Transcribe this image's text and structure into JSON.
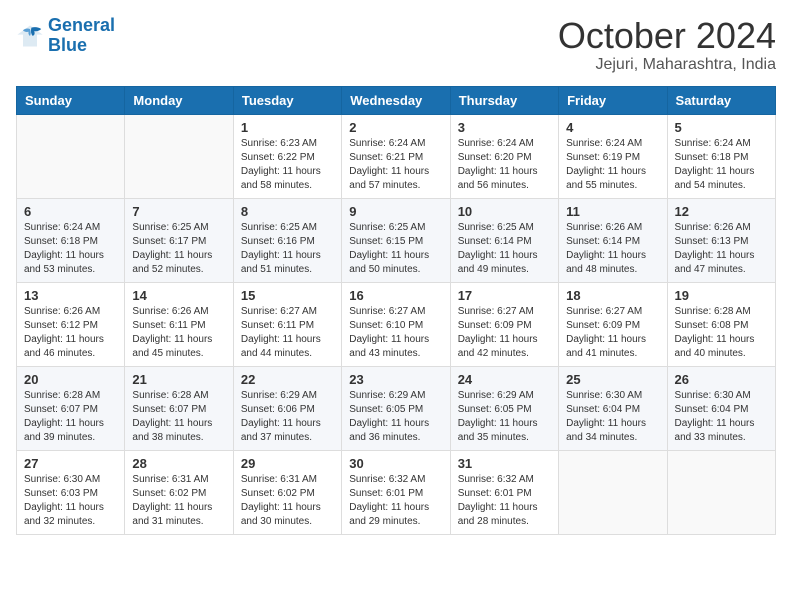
{
  "logo": {
    "general": "General",
    "blue": "Blue"
  },
  "header": {
    "month": "October 2024",
    "location": "Jejuri, Maharashtra, India"
  },
  "weekdays": [
    "Sunday",
    "Monday",
    "Tuesday",
    "Wednesday",
    "Thursday",
    "Friday",
    "Saturday"
  ],
  "weeks": [
    [
      null,
      null,
      {
        "day": 1,
        "sunrise": "6:23 AM",
        "sunset": "6:22 PM",
        "daylight": "11 hours and 58 minutes."
      },
      {
        "day": 2,
        "sunrise": "6:24 AM",
        "sunset": "6:21 PM",
        "daylight": "11 hours and 57 minutes."
      },
      {
        "day": 3,
        "sunrise": "6:24 AM",
        "sunset": "6:20 PM",
        "daylight": "11 hours and 56 minutes."
      },
      {
        "day": 4,
        "sunrise": "6:24 AM",
        "sunset": "6:19 PM",
        "daylight": "11 hours and 55 minutes."
      },
      {
        "day": 5,
        "sunrise": "6:24 AM",
        "sunset": "6:18 PM",
        "daylight": "11 hours and 54 minutes."
      }
    ],
    [
      {
        "day": 6,
        "sunrise": "6:24 AM",
        "sunset": "6:18 PM",
        "daylight": "11 hours and 53 minutes."
      },
      {
        "day": 7,
        "sunrise": "6:25 AM",
        "sunset": "6:17 PM",
        "daylight": "11 hours and 52 minutes."
      },
      {
        "day": 8,
        "sunrise": "6:25 AM",
        "sunset": "6:16 PM",
        "daylight": "11 hours and 51 minutes."
      },
      {
        "day": 9,
        "sunrise": "6:25 AM",
        "sunset": "6:15 PM",
        "daylight": "11 hours and 50 minutes."
      },
      {
        "day": 10,
        "sunrise": "6:25 AM",
        "sunset": "6:14 PM",
        "daylight": "11 hours and 49 minutes."
      },
      {
        "day": 11,
        "sunrise": "6:26 AM",
        "sunset": "6:14 PM",
        "daylight": "11 hours and 48 minutes."
      },
      {
        "day": 12,
        "sunrise": "6:26 AM",
        "sunset": "6:13 PM",
        "daylight": "11 hours and 47 minutes."
      }
    ],
    [
      {
        "day": 13,
        "sunrise": "6:26 AM",
        "sunset": "6:12 PM",
        "daylight": "11 hours and 46 minutes."
      },
      {
        "day": 14,
        "sunrise": "6:26 AM",
        "sunset": "6:11 PM",
        "daylight": "11 hours and 45 minutes."
      },
      {
        "day": 15,
        "sunrise": "6:27 AM",
        "sunset": "6:11 PM",
        "daylight": "11 hours and 44 minutes."
      },
      {
        "day": 16,
        "sunrise": "6:27 AM",
        "sunset": "6:10 PM",
        "daylight": "11 hours and 43 minutes."
      },
      {
        "day": 17,
        "sunrise": "6:27 AM",
        "sunset": "6:09 PM",
        "daylight": "11 hours and 42 minutes."
      },
      {
        "day": 18,
        "sunrise": "6:27 AM",
        "sunset": "6:09 PM",
        "daylight": "11 hours and 41 minutes."
      },
      {
        "day": 19,
        "sunrise": "6:28 AM",
        "sunset": "6:08 PM",
        "daylight": "11 hours and 40 minutes."
      }
    ],
    [
      {
        "day": 20,
        "sunrise": "6:28 AM",
        "sunset": "6:07 PM",
        "daylight": "11 hours and 39 minutes."
      },
      {
        "day": 21,
        "sunrise": "6:28 AM",
        "sunset": "6:07 PM",
        "daylight": "11 hours and 38 minutes."
      },
      {
        "day": 22,
        "sunrise": "6:29 AM",
        "sunset": "6:06 PM",
        "daylight": "11 hours and 37 minutes."
      },
      {
        "day": 23,
        "sunrise": "6:29 AM",
        "sunset": "6:05 PM",
        "daylight": "11 hours and 36 minutes."
      },
      {
        "day": 24,
        "sunrise": "6:29 AM",
        "sunset": "6:05 PM",
        "daylight": "11 hours and 35 minutes."
      },
      {
        "day": 25,
        "sunrise": "6:30 AM",
        "sunset": "6:04 PM",
        "daylight": "11 hours and 34 minutes."
      },
      {
        "day": 26,
        "sunrise": "6:30 AM",
        "sunset": "6:04 PM",
        "daylight": "11 hours and 33 minutes."
      }
    ],
    [
      {
        "day": 27,
        "sunrise": "6:30 AM",
        "sunset": "6:03 PM",
        "daylight": "11 hours and 32 minutes."
      },
      {
        "day": 28,
        "sunrise": "6:31 AM",
        "sunset": "6:02 PM",
        "daylight": "11 hours and 31 minutes."
      },
      {
        "day": 29,
        "sunrise": "6:31 AM",
        "sunset": "6:02 PM",
        "daylight": "11 hours and 30 minutes."
      },
      {
        "day": 30,
        "sunrise": "6:32 AM",
        "sunset": "6:01 PM",
        "daylight": "11 hours and 29 minutes."
      },
      {
        "day": 31,
        "sunrise": "6:32 AM",
        "sunset": "6:01 PM",
        "daylight": "11 hours and 28 minutes."
      },
      null,
      null
    ]
  ],
  "labels": {
    "sunrise": "Sunrise:",
    "sunset": "Sunset:",
    "daylight": "Daylight:"
  }
}
